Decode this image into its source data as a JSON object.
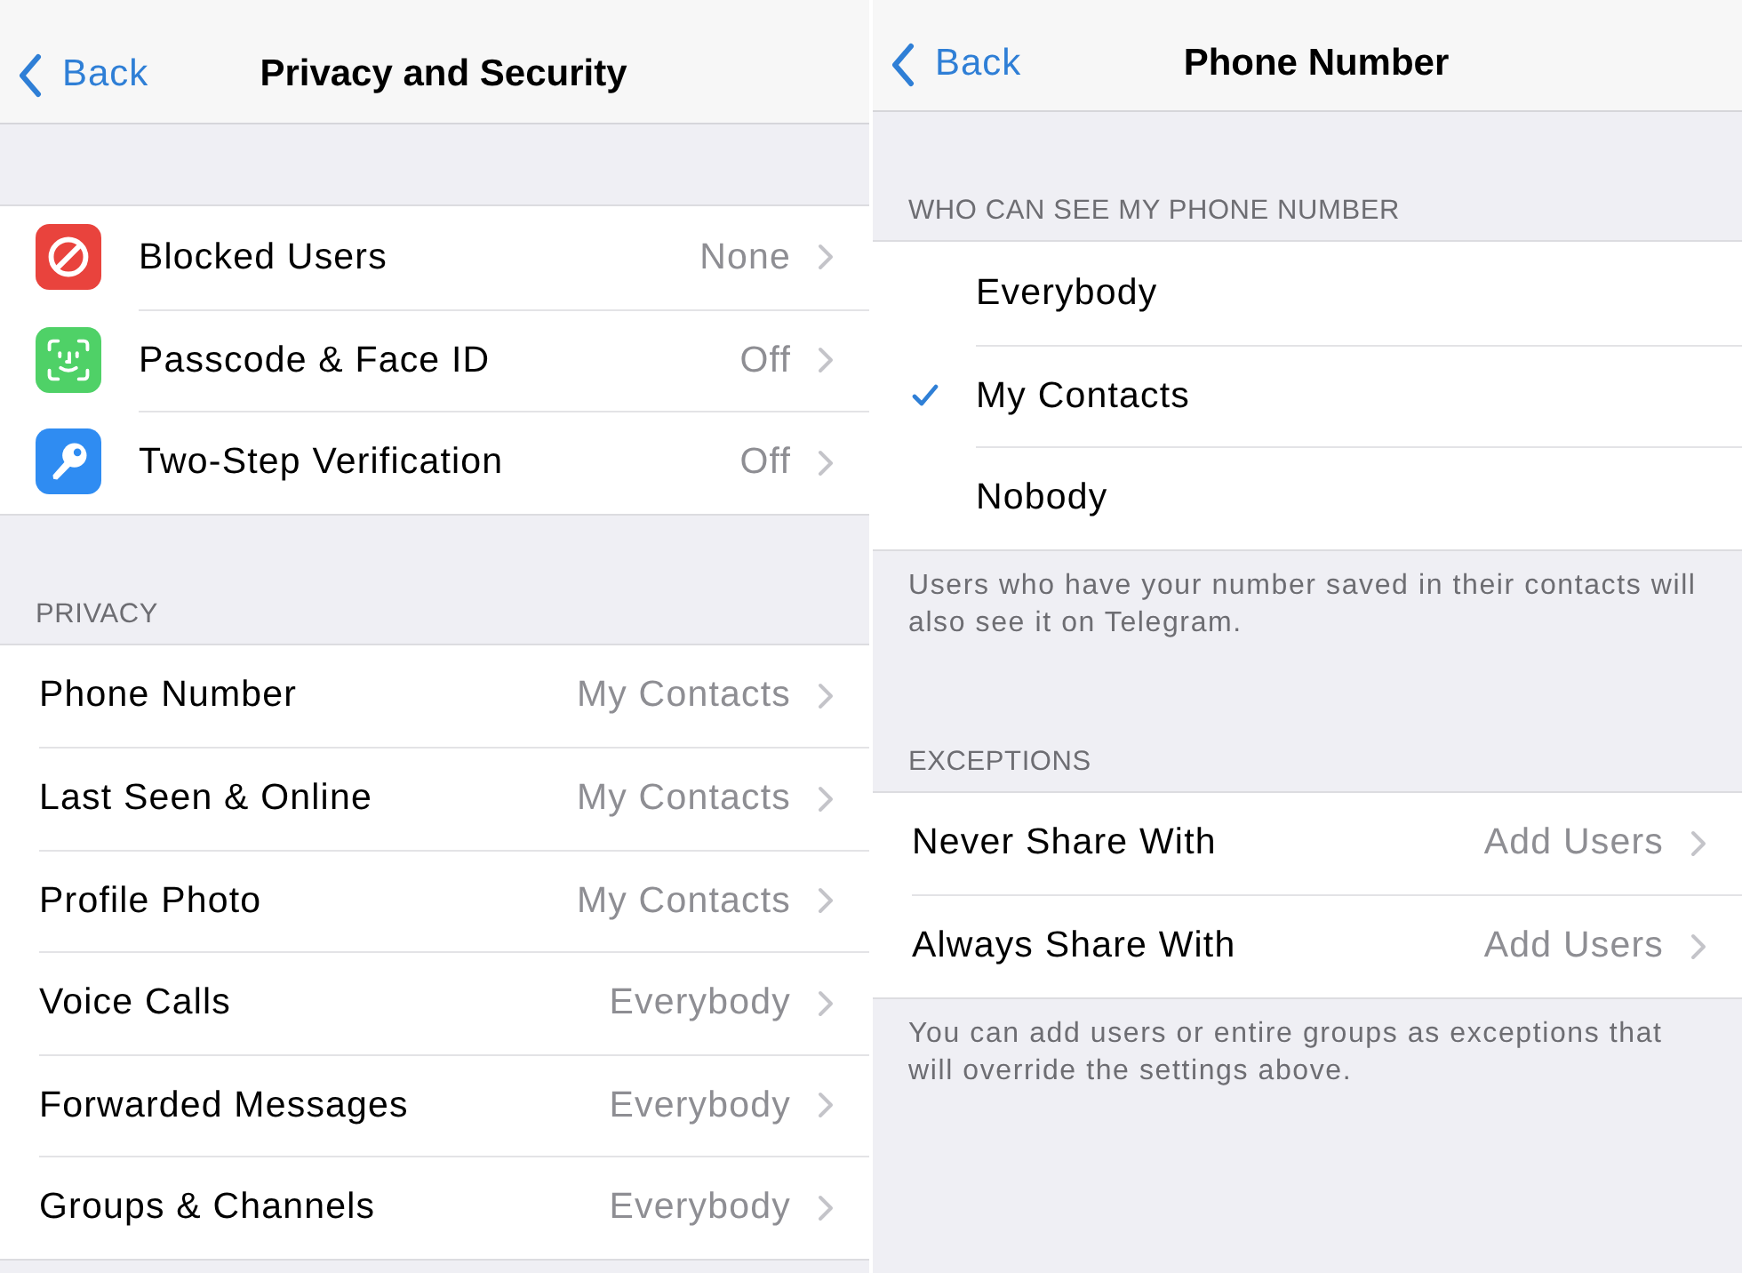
{
  "screens": [
    {
      "nav": {
        "back": "Back",
        "title": "Privacy and Security"
      },
      "sections": [
        {
          "rows": [
            {
              "kind": "blocked",
              "color": "#e9433d",
              "label": "Blocked Users",
              "value": "None"
            },
            {
              "kind": "passcode",
              "color": "#4fd167",
              "label": "Passcode & Face ID",
              "value": "Off"
            },
            {
              "kind": "two-step",
              "color": "#2f8cf2",
              "label": "Two-Step Verification",
              "value": "Off"
            }
          ]
        },
        {
          "header": "PRIVACY",
          "rows": [
            {
              "label": "Phone Number",
              "value": "My Contacts"
            },
            {
              "label": "Last Seen & Online",
              "value": "My Contacts"
            },
            {
              "label": "Profile Photo",
              "value": "My Contacts"
            },
            {
              "label": "Voice Calls",
              "value": "Everybody"
            },
            {
              "label": "Forwarded Messages",
              "value": "Everybody"
            },
            {
              "label": "Groups & Channels",
              "value": "Everybody"
            }
          ]
        }
      ]
    },
    {
      "nav": {
        "back": "Back",
        "title": "Phone Number"
      },
      "sections": [
        {
          "header": "WHO CAN SEE MY PHONE NUMBER",
          "options": [
            {
              "label": "Everybody",
              "selected": false
            },
            {
              "label": "My Contacts",
              "selected": true
            },
            {
              "label": "Nobody",
              "selected": false
            }
          ],
          "footer": "Users who have your number saved in their contacts will also see it on Telegram."
        },
        {
          "header": "EXCEPTIONS",
          "rows": [
            {
              "label": "Never Share With",
              "value": "Add Users"
            },
            {
              "label": "Always Share With",
              "value": "Add Users"
            }
          ],
          "footer": "You can add users or entire groups as exceptions that will override the settings above."
        }
      ]
    }
  ]
}
